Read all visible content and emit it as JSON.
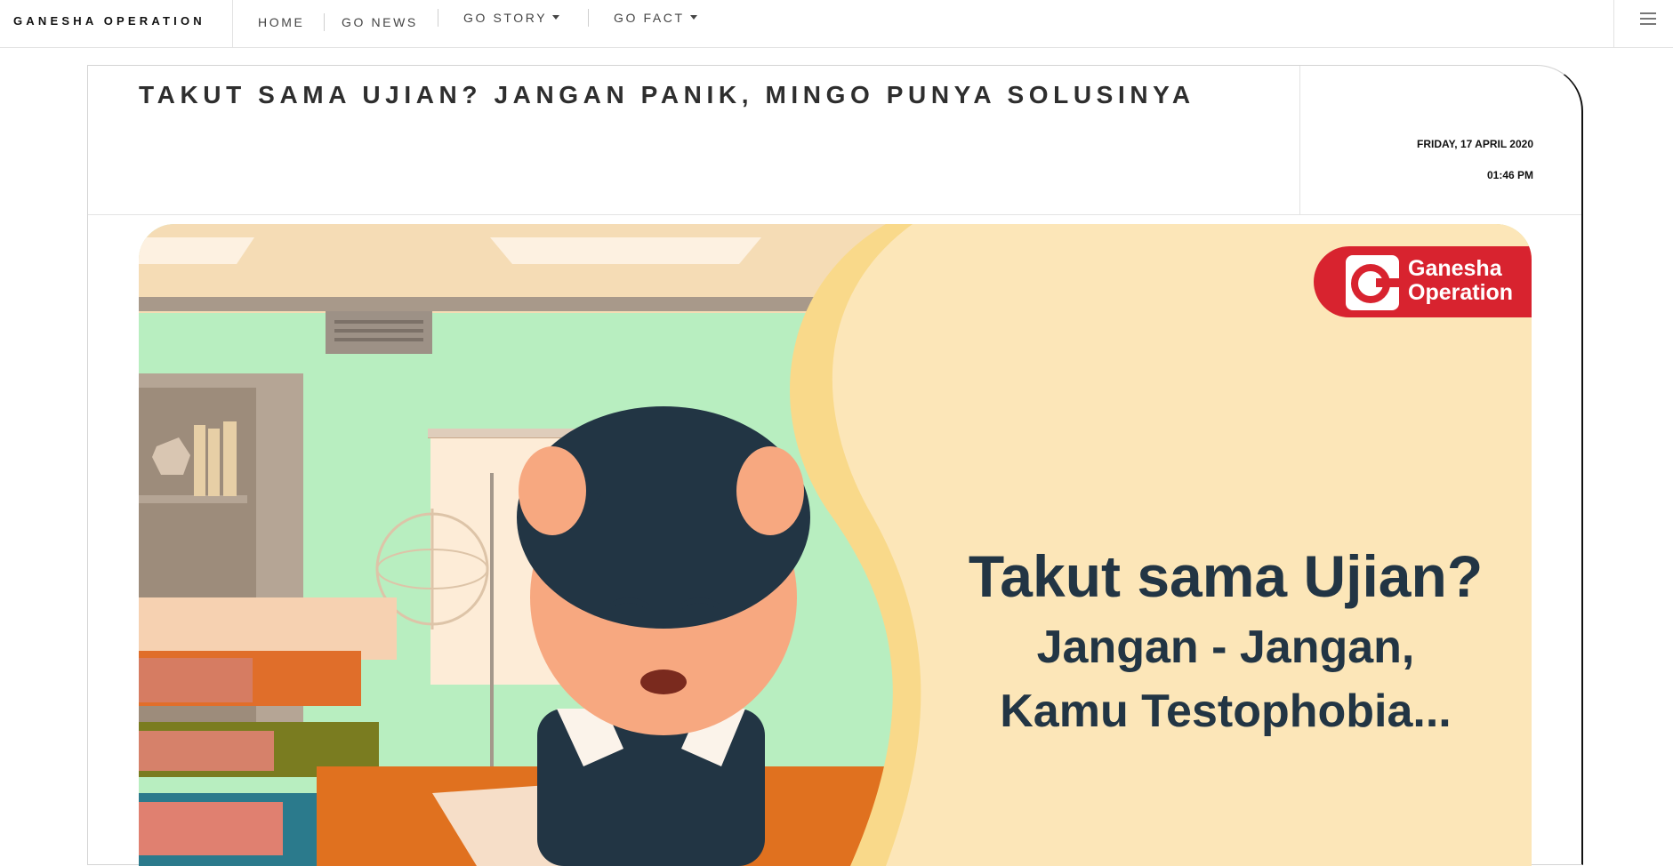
{
  "nav": {
    "brand": "GANESHA OPERATION",
    "items": [
      {
        "label": "HOME"
      },
      {
        "label": "GO NEWS"
      },
      {
        "label": "GO STORY"
      },
      {
        "label": "GO FACT"
      }
    ],
    "menu_icon": "hamburger-icon"
  },
  "article": {
    "title": "TAKUT SAMA UJIAN? JANGAN PANIK, MINGO PUNYA SOLUSINYA",
    "date": "FRIDAY, 17 APRIL 2020",
    "time": "01:46 PM",
    "hero": {
      "logo_text": "Ganesha\nOperation",
      "heading": "Takut sama Ujian?",
      "subheading": "Jangan - Jangan,\nKamu Testophobia..."
    }
  },
  "colors": {
    "brand_red": "#d8232f",
    "hero_text": "#223544",
    "hero_bg": "#fce6b8",
    "classroom_wall": "#b8eec0"
  }
}
